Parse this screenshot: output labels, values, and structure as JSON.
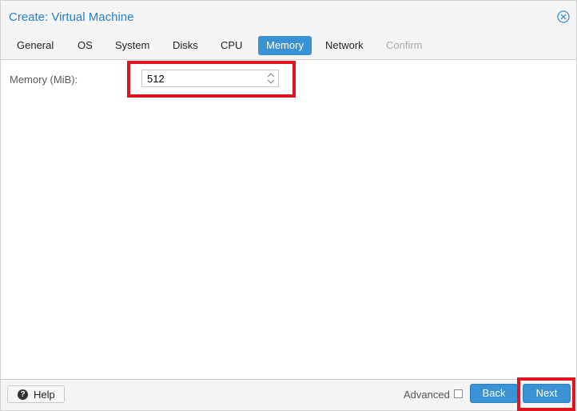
{
  "dialog": {
    "title": "Create: Virtual Machine"
  },
  "tabs": [
    {
      "label": "General",
      "state": "normal"
    },
    {
      "label": "OS",
      "state": "normal"
    },
    {
      "label": "System",
      "state": "normal"
    },
    {
      "label": "Disks",
      "state": "normal"
    },
    {
      "label": "CPU",
      "state": "normal"
    },
    {
      "label": "Memory",
      "state": "active"
    },
    {
      "label": "Network",
      "state": "normal"
    },
    {
      "label": "Confirm",
      "state": "disabled"
    }
  ],
  "memory": {
    "label": "Memory (MiB):",
    "value": "512"
  },
  "footer": {
    "help_label": "Help",
    "advanced_label": "Advanced",
    "advanced_checked": false,
    "back_label": "Back",
    "next_label": "Next"
  },
  "colors": {
    "accent": "#3892d4",
    "title": "#1f7fd0",
    "highlight": "#e0141e"
  },
  "icons": [
    "close-icon",
    "spinner-icon",
    "help-icon"
  ]
}
